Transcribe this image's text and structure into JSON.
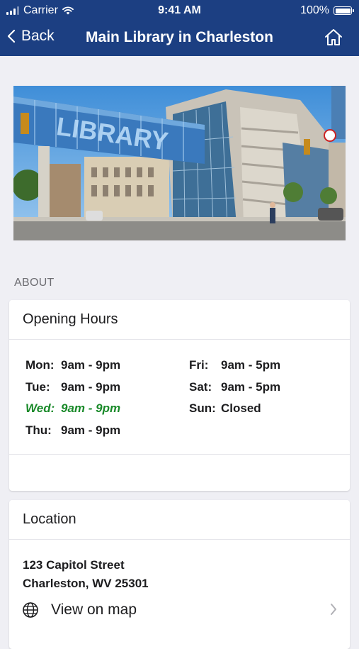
{
  "status_bar": {
    "carrier": "Carrier",
    "time": "9:41 AM",
    "battery": "100%"
  },
  "nav": {
    "back_label": "Back",
    "title": "Main Library in Charleston",
    "home_icon": "home-icon"
  },
  "hero": {
    "sign_text": "LIBRARY"
  },
  "about": {
    "section_label": "ABOUT",
    "hours": {
      "title": "Opening Hours",
      "left": [
        {
          "day": "Mon:",
          "time": "9am - 9pm"
        },
        {
          "day": "Tue:",
          "time": "9am - 9pm"
        },
        {
          "day": "Wed:",
          "time": "9am - 9pm"
        },
        {
          "day": "Thu:",
          "time": "9am - 9pm"
        }
      ],
      "right": [
        {
          "day": "Fri:",
          "time": "9am - 5pm"
        },
        {
          "day": "Sat:",
          "time": "9am - 5pm"
        },
        {
          "day": "Sun:",
          "time": "Closed"
        }
      ],
      "today": "Wed",
      "today_color": "#1a8a2a"
    },
    "location": {
      "title": "Location",
      "address_line1": "123 Capitol Street",
      "address_line2": "Charleston, WV 25301",
      "map_link": "View on map"
    }
  },
  "colors": {
    "nav_bg": "#1c3f82",
    "page_bg": "#efeff4"
  }
}
